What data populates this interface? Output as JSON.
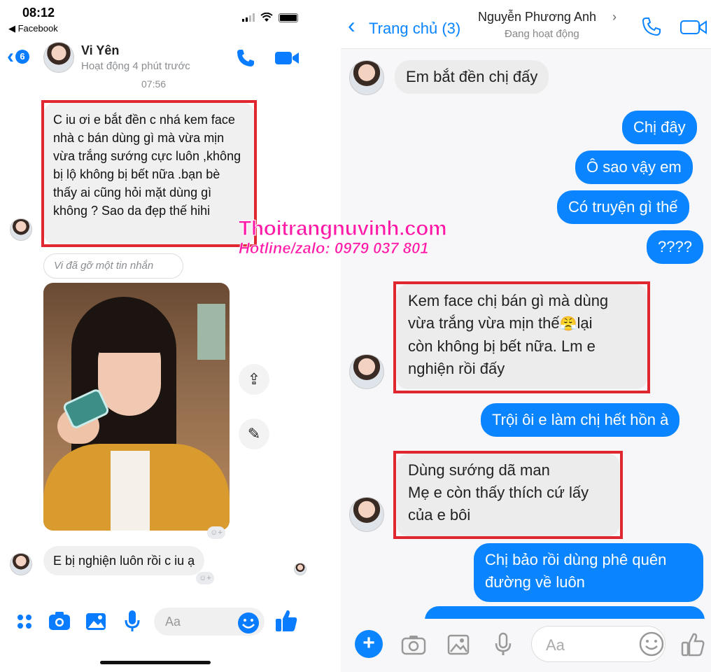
{
  "left": {
    "status": {
      "time": "08:12",
      "back_app": "◀ Facebook"
    },
    "header": {
      "unread_count": "6",
      "name": "Vi Yên",
      "activity": "Hoạt động 4 phút trước",
      "icons": {
        "call": "phone-icon",
        "video": "video-camera-icon"
      }
    },
    "timestamp": "07:56",
    "messages": {
      "first": "C iu ơi e bắt đền c nhá kem face nhà c bán dùng gì mà vừa mịn vừa trắng sướng cực luôn ,không bị lộ không bị bết nữa .bạn bè thấy ai cũng hỏi mặt dùng gì không ? Sao da đẹp thế hihi",
      "removed": "Vi đã gỡ một tin nhắn",
      "last": "E bị nghiện luôn rồi c iu ạ"
    },
    "composer": {
      "placeholder": "Aa"
    },
    "accent_color": "#0a7cff"
  },
  "right": {
    "header": {
      "back_label": "Trang chủ (3)",
      "name": "Nguyễn Phương Anh",
      "status": "Đang hoạt động",
      "icons": {
        "call": "phone-icon",
        "video": "video-camera-icon"
      }
    },
    "messages": {
      "in1": "Em bắt đền chị đấy",
      "out1": "Chị đây",
      "out2": "Ô sao vậy em",
      "out3": "Có truyện gì thế",
      "out4": "????",
      "in2_line1": "Kem face chị bán gì mà dùng",
      "in2_line2": "vừa trắng vừa mịn thế",
      "in2_line2b": "lại",
      "in2_line3": "còn không bị bết nữa. Lm e",
      "in2_line4": "nghiện rồi đấy",
      "out5": "Trội ôi e làm chị hết hồn à",
      "in3_line1": "Dùng sướng dã man",
      "in3_line2": "Mẹ e còn thấy thích cứ lấy",
      "in3_line3": "của e bôi",
      "out6_line1": "Chị bảo rồi dùng phê quên",
      "out6_line2": "đường về luôn"
    },
    "composer": {
      "placeholder": "Aa"
    },
    "accent_color": "#0a84ff"
  },
  "watermark": {
    "site": "Thoitrangnuvinh.com",
    "hotline": "Hotline/zalo: 0979 037 801",
    "color": "#ff1aa8"
  },
  "highlight_color": "#e0262f"
}
